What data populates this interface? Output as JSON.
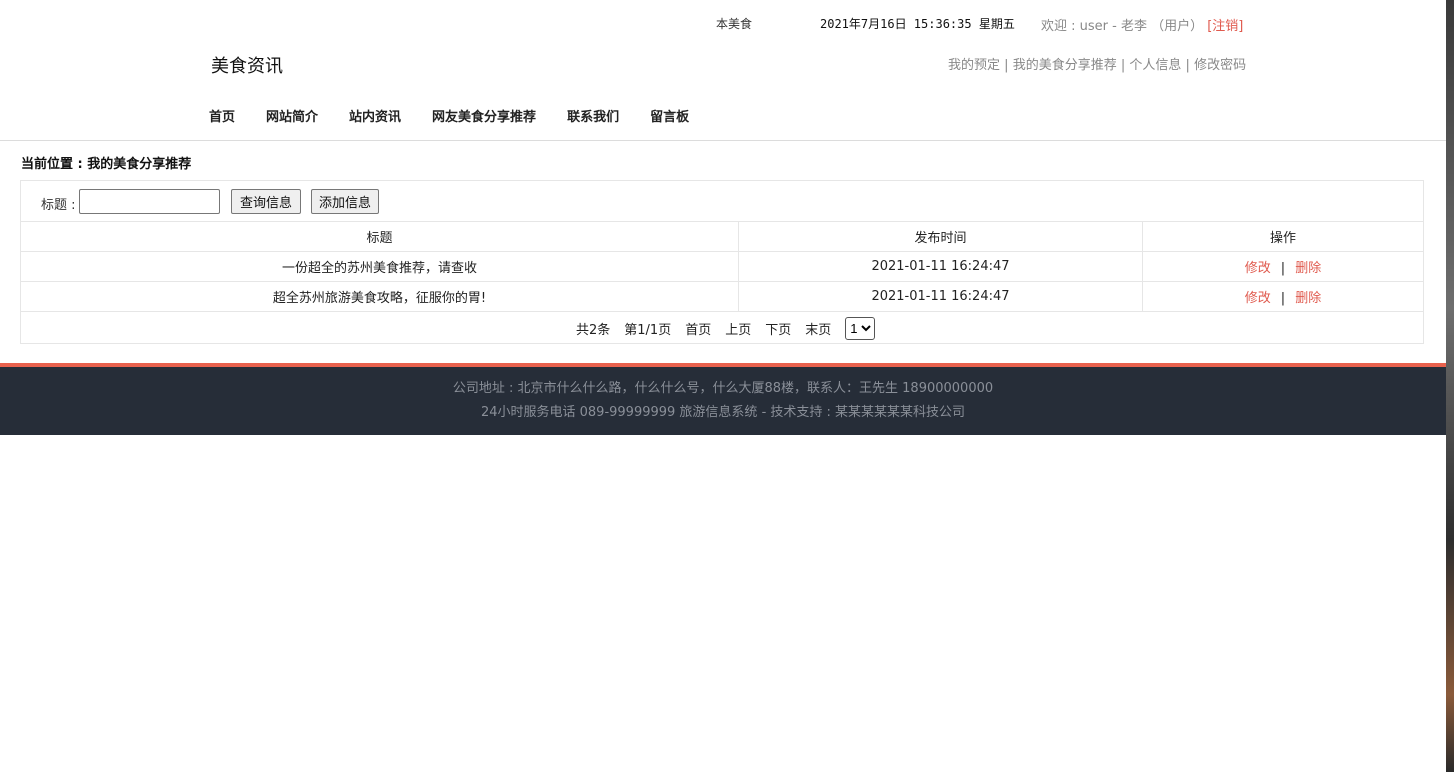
{
  "top": {
    "marquee_text": "本美食资讯",
    "clock": "2021年7月16日 15:36:35 星期五",
    "welcome_prefix": "欢迎 : user - 老李 （用户）",
    "logout": "[注销]"
  },
  "header": {
    "site_title": "美食资讯",
    "user_links": [
      {
        "label": "我的预定"
      },
      {
        "label": "我的美食分享推荐"
      },
      {
        "label": "个人信息"
      },
      {
        "label": "修改密码"
      }
    ],
    "separator": "|"
  },
  "nav": {
    "items": [
      {
        "label": "首页"
      },
      {
        "label": "网站简介"
      },
      {
        "label": "站内资讯"
      },
      {
        "label": "网友美食分享推荐"
      },
      {
        "label": "联系我们"
      },
      {
        "label": "留言板"
      }
    ]
  },
  "breadcrumb": "当前位置 : 我的美食分享推荐",
  "search": {
    "label": "标题 :",
    "value": "",
    "query_button": "查询信息",
    "add_button": "添加信息"
  },
  "table": {
    "columns": [
      "标题",
      "发布时间",
      "操作"
    ],
    "rows": [
      {
        "title": "一份超全的苏州美食推荐，请查收",
        "time": "2021-01-11 16:24:47",
        "edit": "修改",
        "delete": "删除"
      },
      {
        "title": "超全苏州旅游美食攻略，征服你的胃!",
        "time": "2021-01-11 16:24:47",
        "edit": "修改",
        "delete": "删除"
      }
    ],
    "op_separator": "|"
  },
  "pager": {
    "total": "共2条",
    "page_info": "第1/1页",
    "first": "首页",
    "prev": "上页",
    "next": "下页",
    "last": "末页",
    "selected_page": "1"
  },
  "footer": {
    "line1": "公司地址 : 北京市什么什么路，什么什么号，什么大厦88楼，联系人：王先生 18900000000",
    "line2": "24小时服务电话 089-99999999 旅游信息系统 - 技术支持 : 某某某某某某科技公司"
  },
  "colors": {
    "accent": "#e05a4e",
    "footer_bg": "#262d38",
    "footer_stripe": "#e8614d"
  }
}
